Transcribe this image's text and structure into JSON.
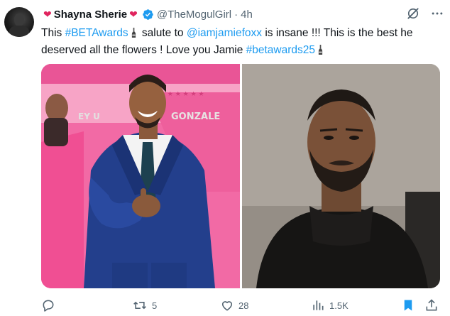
{
  "author": {
    "display_name": "Shayna Sherie",
    "heart_left": "❤",
    "heart_right": "❤",
    "handle": "@TheMogulGirl",
    "separator": "·",
    "time": "4h",
    "verified": true
  },
  "tweet": {
    "segments": [
      {
        "type": "text",
        "value": "This "
      },
      {
        "type": "hashtag",
        "value": "#BETAwards"
      },
      {
        "type": "emoji",
        "value": "bottle"
      },
      {
        "type": "text",
        "value": " salute to "
      },
      {
        "type": "mention",
        "value": "@iamjamiefoxx"
      },
      {
        "type": "text",
        "value": " is insane !!! This is the best he deserved all the flowers ! Love you Jamie "
      },
      {
        "type": "hashtag",
        "value": "#betawards25"
      },
      {
        "type": "emoji",
        "value": "bottle"
      }
    ]
  },
  "media": {
    "photo_left": {
      "name": "red-carpet-photo",
      "sign_text_1": "EY U",
      "sign_text_2": "GONZALE"
    },
    "photo_right": {
      "name": "portrait-photo"
    }
  },
  "actions": {
    "reply": {
      "icon": "reply-icon",
      "count": ""
    },
    "retweet": {
      "icon": "retweet-icon",
      "count": "5"
    },
    "like": {
      "icon": "heart-outline-icon",
      "count": "28"
    },
    "views": {
      "icon": "views-chart-icon",
      "count": "1.5K"
    },
    "bookmark": {
      "icon": "bookmark-filled-icon",
      "count": ""
    },
    "share": {
      "icon": "share-icon",
      "count": ""
    }
  },
  "colors": {
    "link": "#1d9bf0",
    "secondary": "#536471",
    "heart": "#e0245e",
    "bookmark_active": "#1d9bf0",
    "verified": "#1d9bf0"
  }
}
